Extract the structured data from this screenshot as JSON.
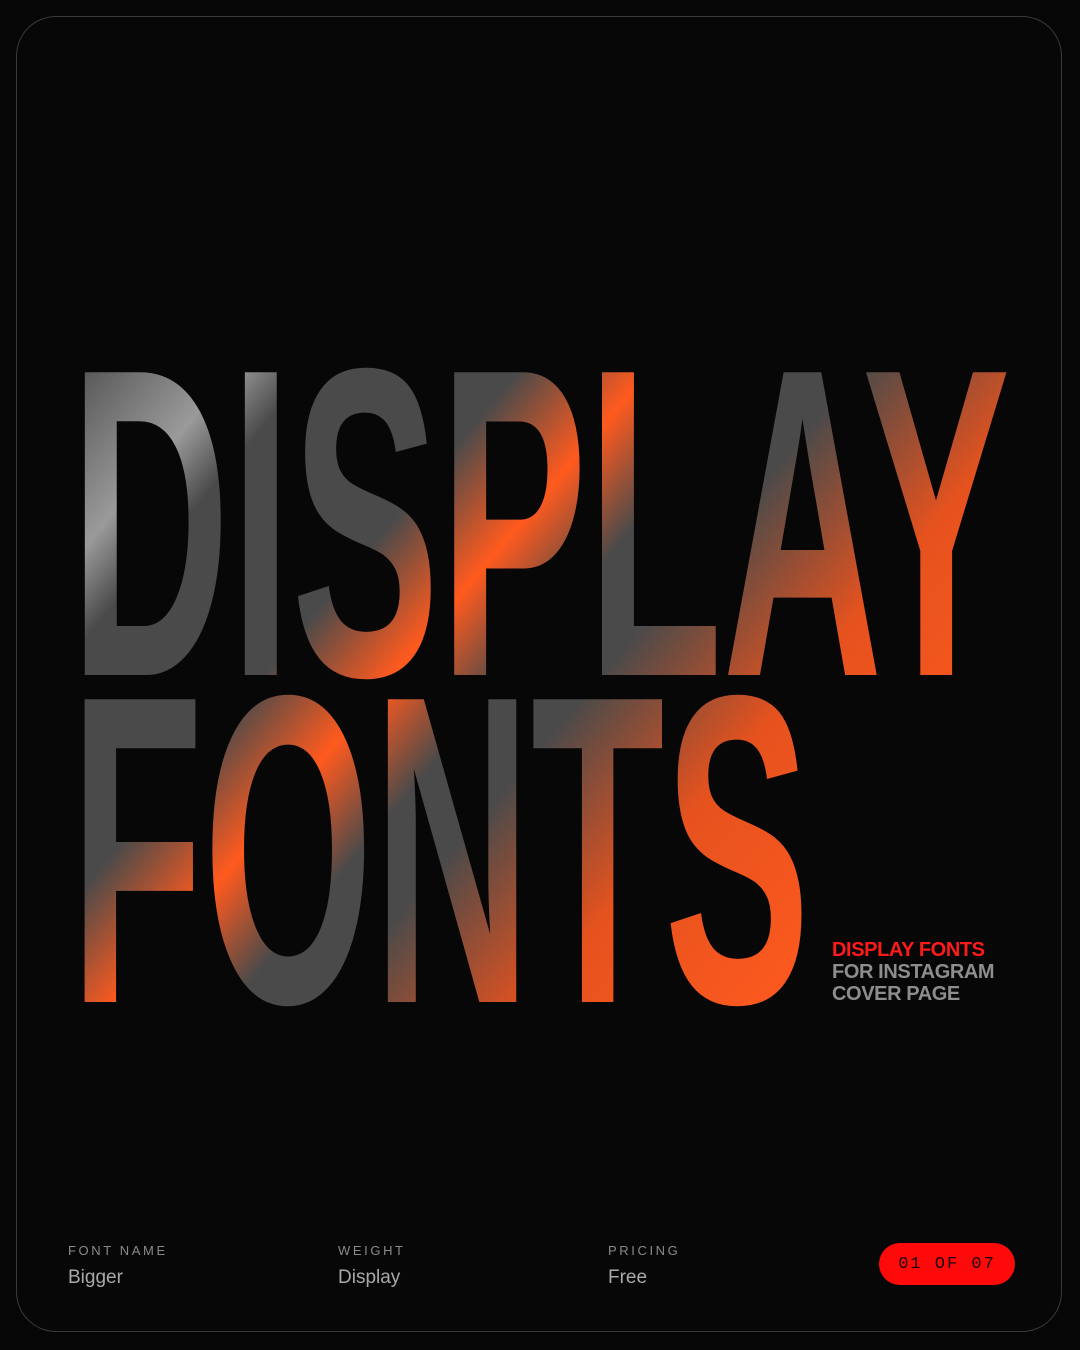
{
  "title": {
    "line1": "DISPLAY",
    "line2": "FONTS"
  },
  "subtitle": {
    "line1": "DISPLAY FONTS",
    "line2": "FOR INSTAGRAM",
    "line3": "COVER PAGE"
  },
  "meta": [
    {
      "label": "FONT NAME",
      "value": "Bigger"
    },
    {
      "label": "WEIGHT",
      "value": "Display"
    },
    {
      "label": "PRICING",
      "value": "Free"
    }
  ],
  "pager": {
    "text": "01 OF 07"
  },
  "colors": {
    "background": "#070707",
    "title_gray": "#4a4a4a",
    "accent_red": "#ff1a1a",
    "glow_orange": "#ff5a1e"
  }
}
